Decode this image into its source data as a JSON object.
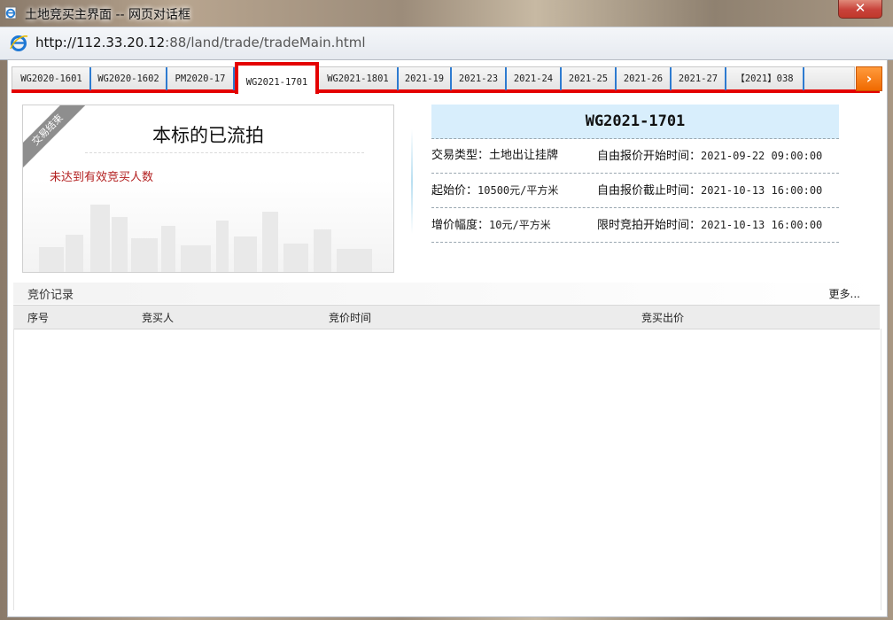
{
  "window": {
    "title": "土地竞买主界面 -- 网页对话框",
    "close_label": "✕"
  },
  "address": {
    "url_host": "http://112.33.20.12",
    "url_rest": ":88/land/trade/tradeMain.html"
  },
  "tabs": [
    {
      "label": "WG2020-1601",
      "active": false
    },
    {
      "label": "WG2020-1602",
      "active": false
    },
    {
      "label": "PM2020-17",
      "active": false
    },
    {
      "label": "WG2021-1701",
      "active": true
    },
    {
      "label": "WG2021-1801",
      "active": false
    },
    {
      "label": "2021-19",
      "active": false
    },
    {
      "label": "2021-23",
      "active": false
    },
    {
      "label": "2021-24",
      "active": false
    },
    {
      "label": "2021-25",
      "active": false
    },
    {
      "label": "2021-26",
      "active": false
    },
    {
      "label": "2021-27",
      "active": false
    },
    {
      "label": "【2021】038",
      "active": false
    }
  ],
  "status": {
    "ribbon": "交易结束",
    "title": "本标的已流拍",
    "reason": "未达到有效竞买人数"
  },
  "info": {
    "code": "WG2021-1701",
    "rows": [
      {
        "l1": "交易类型：",
        "v1": "土地出让挂牌",
        "l2": "自由报价开始时间：",
        "v2": "2021-09-22 09:00:00"
      },
      {
        "l1": "起始价：",
        "v1": "10500元/平方米",
        "l2": "自由报价截止时间：",
        "v2": "2021-10-13 16:00:00"
      },
      {
        "l1": "增价幅度：",
        "v1": "10元/平方米",
        "l2": "限时竞拍开始时间：",
        "v2": "2021-10-13 16:00:00"
      }
    ]
  },
  "bids": {
    "title": "竞价记录",
    "more": "更多...",
    "columns": [
      "序号",
      "竞买人",
      "竞价时间",
      "竞买出价"
    ],
    "rows": []
  },
  "colors": {
    "accent_red": "#e40000",
    "tab_separator": "#2e7bd0",
    "info_header_bg": "#d8eefc",
    "reason_text": "#b21e1e",
    "next_button": "#f06a00"
  }
}
